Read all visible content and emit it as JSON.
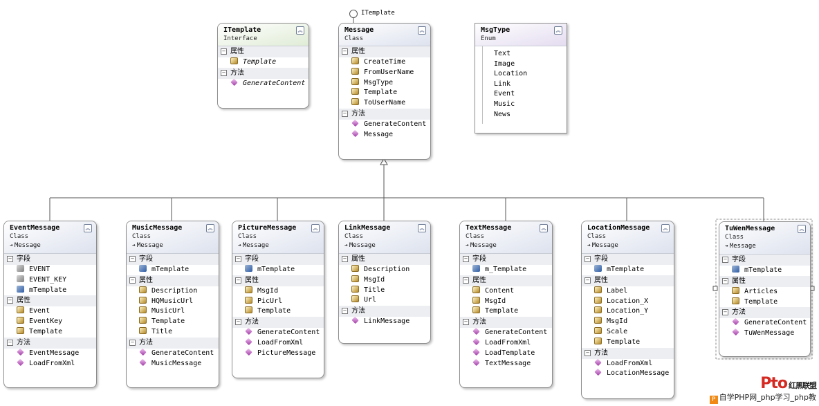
{
  "lollipop_label": "ITemplate",
  "section_labels": {
    "fields": "字段",
    "properties": "属性",
    "methods": "方法"
  },
  "boxes": {
    "itemplate": {
      "title": "ITemplate",
      "kind": "Interface",
      "properties": [
        "Template"
      ],
      "methods": [
        "GenerateContent"
      ]
    },
    "message": {
      "title": "Message",
      "kind": "Class",
      "properties": [
        "CreateTime",
        "FromUserName",
        "MsgType",
        "Template",
        "ToUserName"
      ],
      "methods": [
        "GenerateContent",
        "Message"
      ]
    },
    "msgtype": {
      "title": "MsgType",
      "kind": "Enum",
      "items": [
        "Text",
        "Image",
        "Location",
        "Link",
        "Event",
        "Music",
        "News"
      ]
    },
    "event": {
      "title": "EventMessage",
      "kind": "Class",
      "base": "Message",
      "fields": [
        "EVENT",
        "EVENT_KEY",
        "mTemplate"
      ],
      "properties": [
        "Event",
        "EventKey",
        "Template"
      ],
      "methods": [
        "EventMessage",
        "LoadFromXml"
      ]
    },
    "music": {
      "title": "MusicMessage",
      "kind": "Class",
      "base": "Message",
      "fields": [
        "mTemplate"
      ],
      "properties": [
        "Description",
        "HQMusicUrl",
        "MusicUrl",
        "Template",
        "Title"
      ],
      "methods": [
        "GenerateContent",
        "MusicMessage"
      ]
    },
    "picture": {
      "title": "PictureMessage",
      "kind": "Class",
      "base": "Message",
      "fields": [
        "mTemplate"
      ],
      "properties": [
        "MsgId",
        "PicUrl",
        "Template"
      ],
      "methods": [
        "GenerateContent",
        "LoadFromXml",
        "PictureMessage"
      ]
    },
    "link": {
      "title": "LinkMessage",
      "kind": "Class",
      "base": "Message",
      "properties": [
        "Description",
        "MsgId",
        "Title",
        "Url"
      ],
      "methods": [
        "LinkMessage"
      ]
    },
    "text": {
      "title": "TextMessage",
      "kind": "Class",
      "base": "Message",
      "fields": [
        "m_Template"
      ],
      "properties": [
        "Content",
        "MsgId",
        "Template"
      ],
      "methods": [
        "GenerateContent",
        "LoadFromXml",
        "LoadTemplate",
        "TextMessage"
      ]
    },
    "location": {
      "title": "LocationMessage",
      "kind": "Class",
      "base": "Message",
      "fields": [
        "mTemplate"
      ],
      "properties": [
        "Label",
        "Location_X",
        "Location_Y",
        "MsgId",
        "Scale",
        "Template"
      ],
      "methods": [
        "LoadFromXml",
        "LocationMessage"
      ]
    },
    "tuwen": {
      "title": "TuWenMessage",
      "kind": "Class",
      "base": "Message",
      "fields": [
        "mTemplate"
      ],
      "properties": [
        "Articles",
        "Template"
      ],
      "methods": [
        "GenerateContent",
        "TuWenMessage"
      ]
    }
  },
  "watermark": {
    "logo": "Pto",
    "brand": "红黑联盟",
    "text": "自学PHP网_php学习_php教"
  }
}
